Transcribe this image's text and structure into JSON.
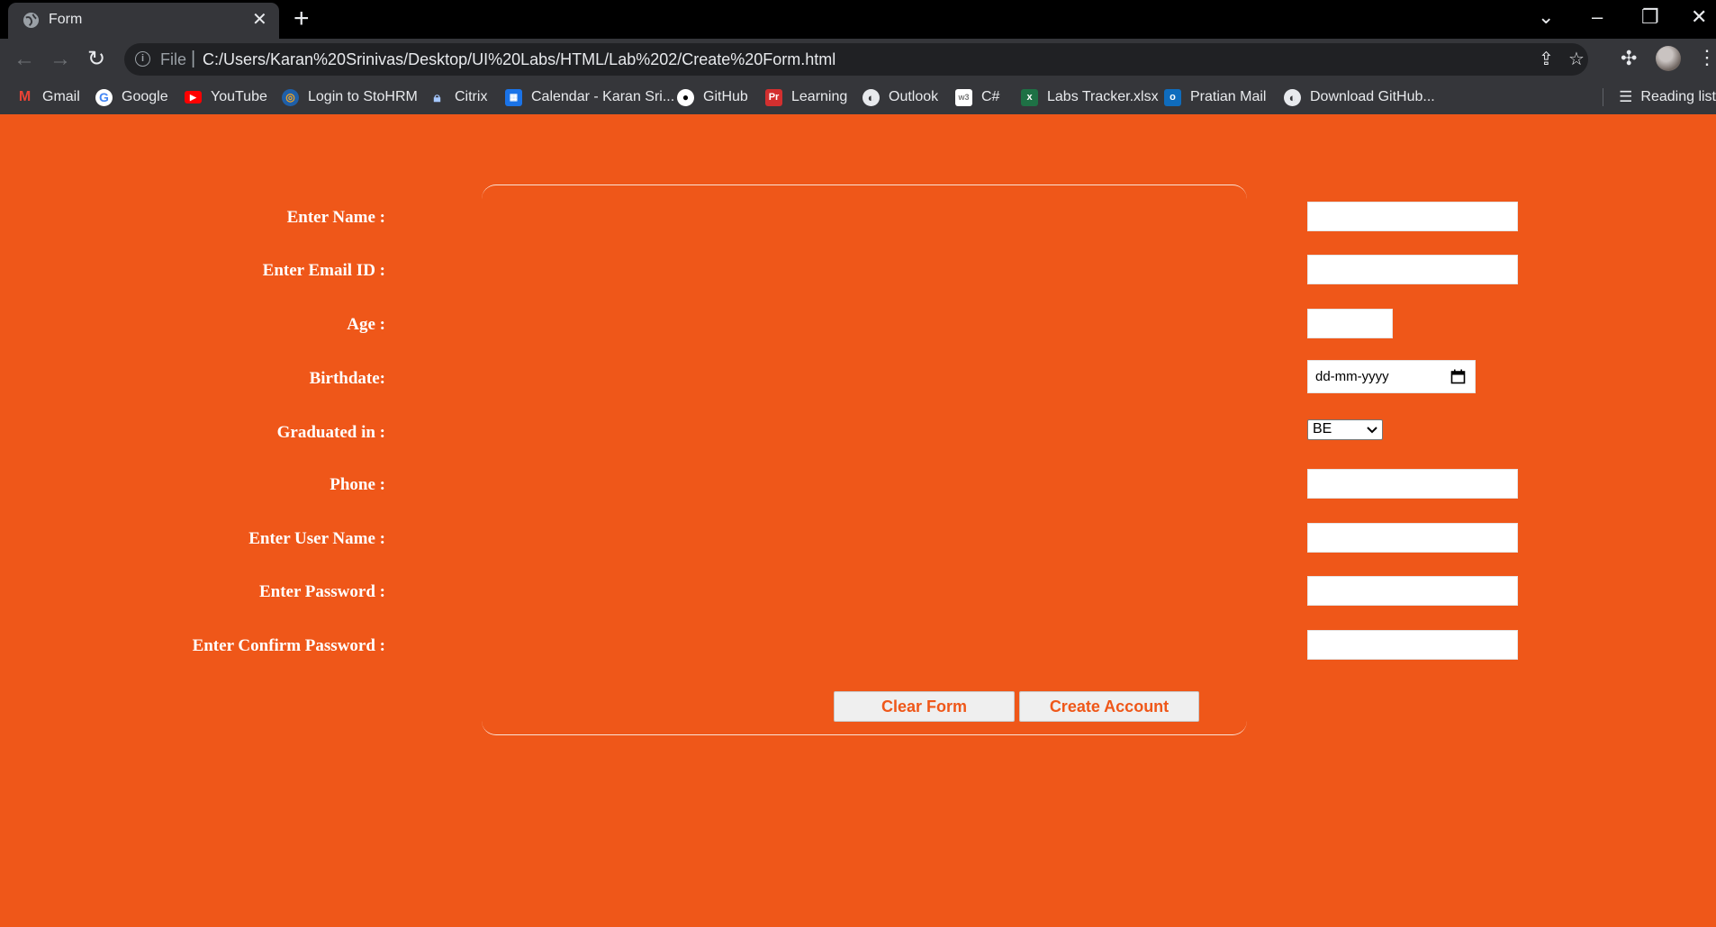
{
  "browser": {
    "tab_title": "Form",
    "tab_close": "✕",
    "new_tab": "+",
    "scheme_label": "File",
    "url": "C:/Users/Karan%20Srinivas/Desktop/UI%20Labs/HTML/Lab%202/Create%20Form.html",
    "bookmarks": [
      {
        "label": "Gmail",
        "icon": "gmail-icon"
      },
      {
        "label": "Google",
        "icon": "google-icon"
      },
      {
        "label": "YouTube",
        "icon": "youtube-icon"
      },
      {
        "label": "Login to StoHRM",
        "icon": "stohrm-icon"
      },
      {
        "label": "Citrix",
        "icon": "citrix-icon"
      },
      {
        "label": "Calendar - Karan Sri...",
        "icon": "calendar-icon"
      },
      {
        "label": "GitHub",
        "icon": "github-icon"
      },
      {
        "label": "Learning",
        "icon": "pr-icon"
      },
      {
        "label": "Outlook",
        "icon": "globe-icon"
      },
      {
        "label": "C#",
        "icon": "w3-icon"
      },
      {
        "label": "Labs Tracker.xlsx",
        "icon": "excel-icon"
      },
      {
        "label": "Pratian Mail",
        "icon": "outlook-icon"
      },
      {
        "label": "Download GitHub...",
        "icon": "globe-icon"
      }
    ],
    "reading_list": "Reading list"
  },
  "form": {
    "name_label": "Enter Name :",
    "email_label": "Enter Email ID :",
    "age_label": "Age :",
    "birthdate_label": "Birthdate:",
    "birthdate_placeholder": "dd-mm-yyyy",
    "graduated_label": "Graduated in :",
    "graduated_value": "BE",
    "phone_label": "Phone :",
    "username_label": "Enter User Name :",
    "password_label": "Enter Password :",
    "confirm_password_label": "Enter Confirm Password :",
    "clear_button": "Clear Form",
    "create_button": "Create Account"
  },
  "colors": {
    "page_background": "#ef5719",
    "chrome_dark": "#35363a",
    "button_text": "#ef5719"
  }
}
